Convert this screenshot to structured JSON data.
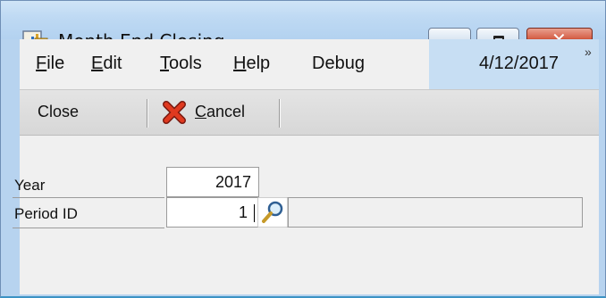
{
  "window": {
    "title": "Month End Closing",
    "min_icon": "minimize-icon",
    "max_icon": "maximize-icon",
    "close_icon": "close-icon",
    "close_glyph": "✕"
  },
  "menu": {
    "items": [
      {
        "label": "File",
        "accel": "F",
        "rest": "ile"
      },
      {
        "label": "Edit",
        "accel": "E",
        "rest": "dit"
      },
      {
        "label": "Tools",
        "accel": "T",
        "rest": "ools"
      },
      {
        "label": "Help",
        "accel": "H",
        "rest": "elp"
      },
      {
        "label": "Debug",
        "pre": "Debu",
        "accel": "g"
      }
    ],
    "user_date": "4/12/2017",
    "overflow": "»"
  },
  "toolbar": {
    "close_label": "Close",
    "cancel_accel": "C",
    "cancel_rest": "ancel",
    "cancel_icon": "red-x-icon"
  },
  "form": {
    "year_label": "Year",
    "year_value": "2017",
    "period_label": "Period ID",
    "period_value": "1",
    "period_lookup_icon": "lookup-magnifier-icon",
    "period_description": ""
  },
  "colors": {
    "titlebar": "#bed9f3",
    "menubar": "#f0f0f0",
    "date_area": "#c7def3",
    "toolbar": "#dcdcdc",
    "close_button": "#c2391f"
  }
}
